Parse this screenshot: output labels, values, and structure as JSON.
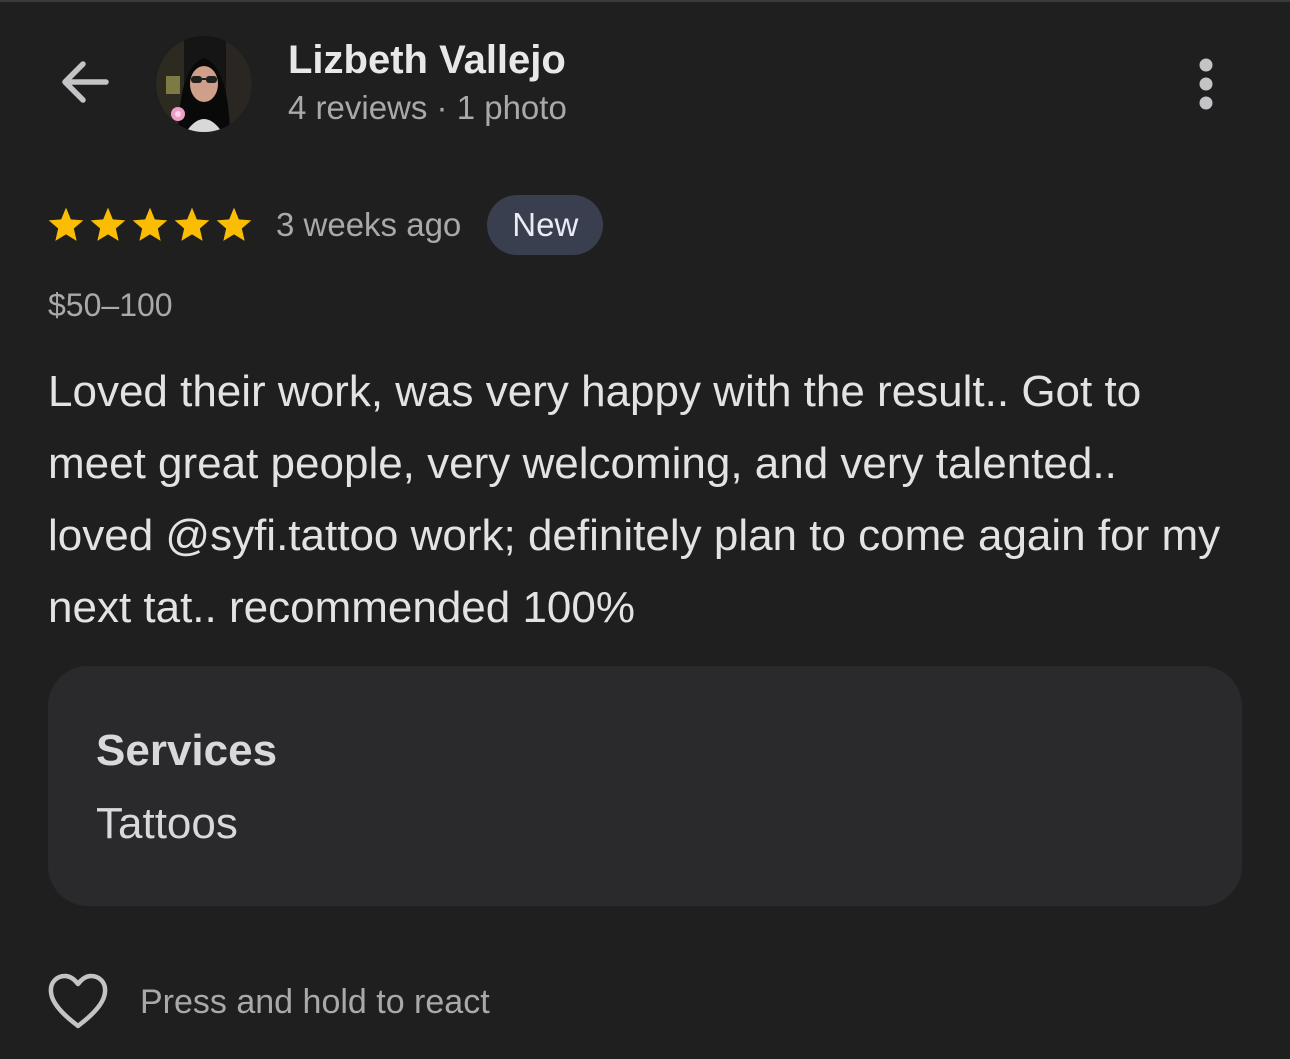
{
  "header": {
    "reviewer_name": "Lizbeth Vallejo",
    "reviewer_stats": "4 reviews · 1 photo",
    "back_icon": "arrow-back-icon",
    "more_icon": "more-vertical-icon"
  },
  "review": {
    "rating": 5,
    "rating_max": 5,
    "date": "3 weeks ago",
    "badge": "New",
    "price": "$50–100",
    "text": "Loved their work, was very happy with the result.. Got to meet great people, very welcoming, and very talented.. loved @syfi.tattoo work; definitely plan to come again for my next tat.. recommended 100%"
  },
  "services": {
    "title": "Services",
    "value": "Tattoos"
  },
  "react": {
    "label": "Press and hold to react",
    "icon": "heart-outline-icon"
  },
  "colors": {
    "background": "#1f1f20",
    "star": "#fbbc04",
    "badge_bg": "#3a3f4f",
    "card_bg": "#2a2a2d",
    "secondary_text": "#a9a9ab"
  }
}
